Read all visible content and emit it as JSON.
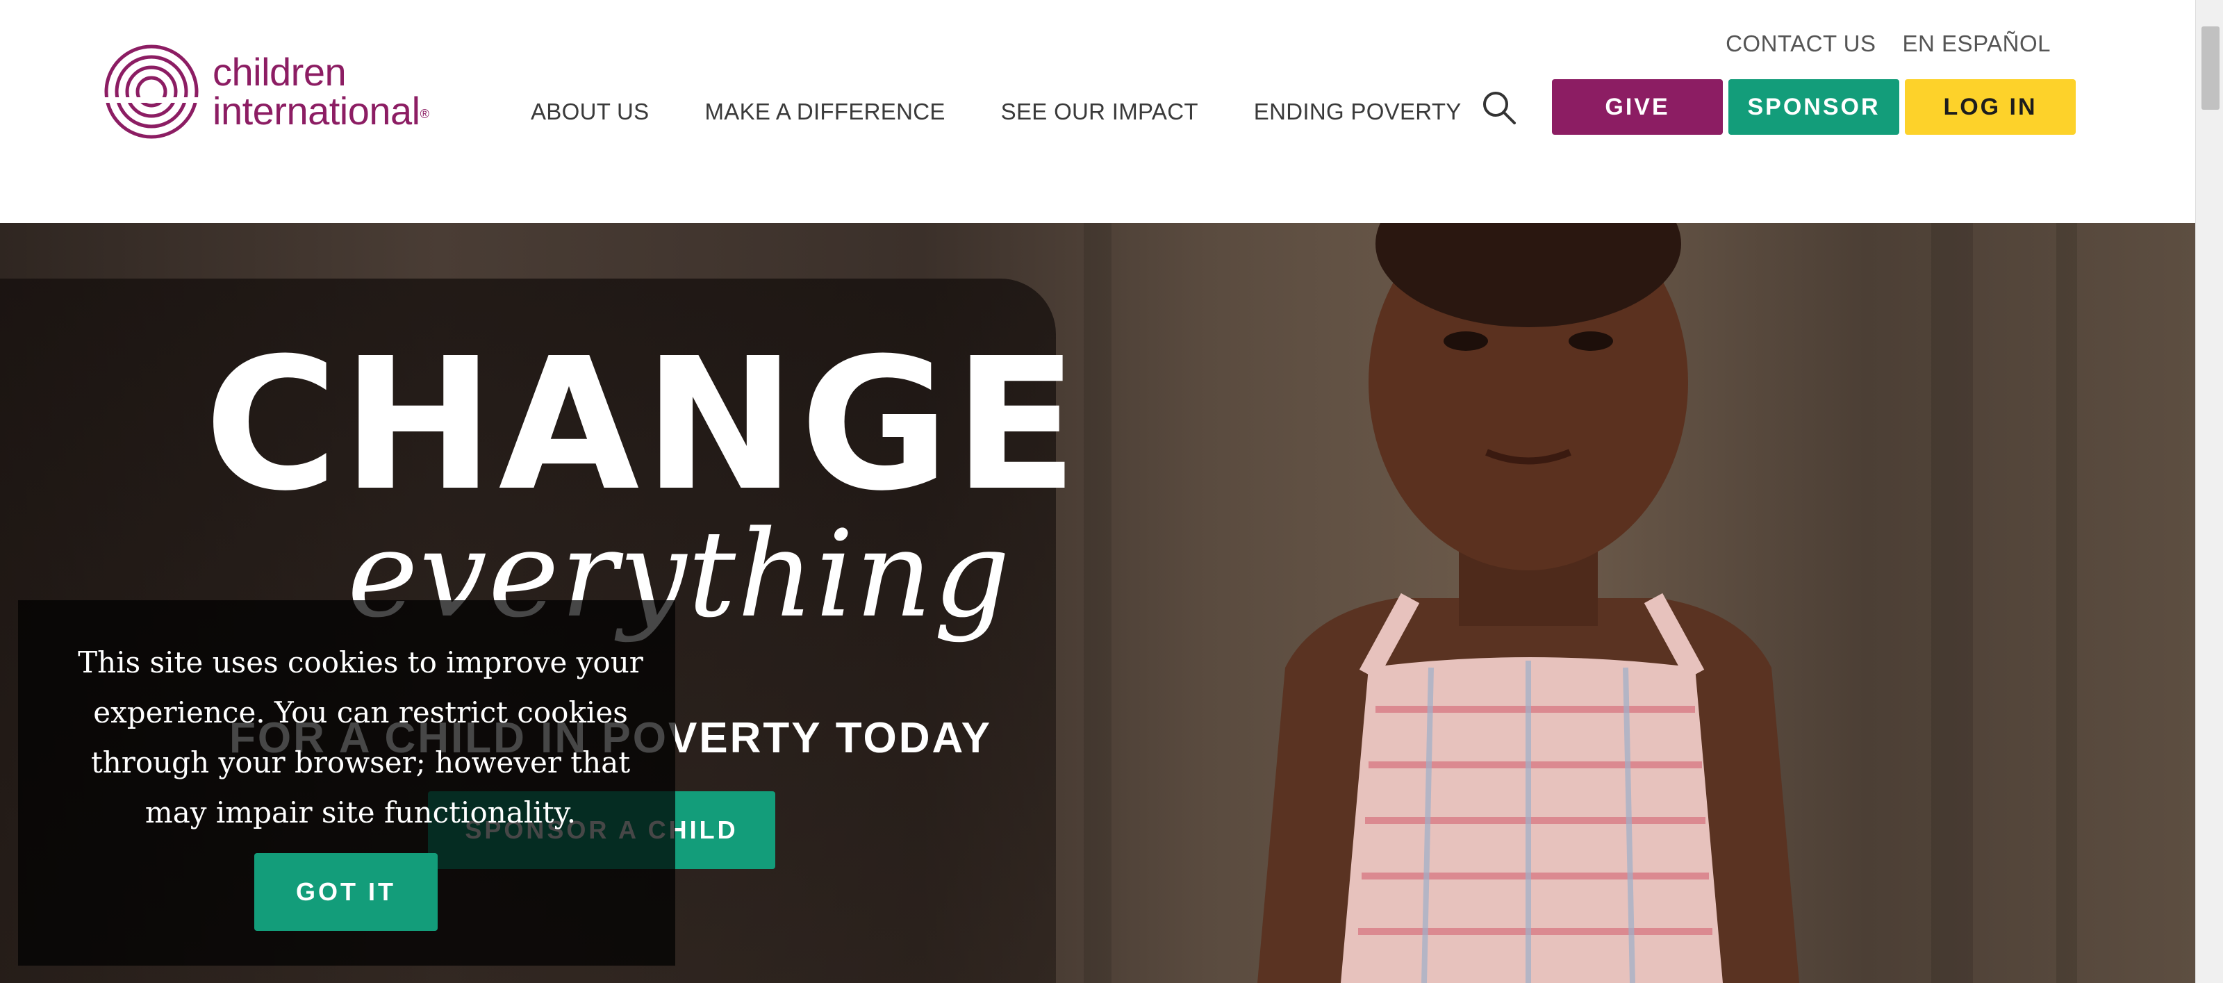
{
  "brand": {
    "line1": "children",
    "line2": "international",
    "registered_mark": "®",
    "color": "#8c1d63"
  },
  "utility_nav": [
    "CONTACT US",
    "EN ESPAÑOL"
  ],
  "main_nav": [
    "ABOUT US",
    "MAKE A DIFFERENCE",
    "SEE OUR IMPACT",
    "ENDING POVERTY"
  ],
  "actions": {
    "give": "GIVE",
    "sponsor": "SPONSOR",
    "login": "LOG IN"
  },
  "hero": {
    "headline": "CHANGE",
    "script": "everything",
    "tagline": "FOR A CHILD IN POVERTY TODAY",
    "cta": "SPONSOR A CHILD"
  },
  "cookie_banner": {
    "message": "This site uses cookies to improve your experience. You can restrict cookies through your browser; however that may impair site functionality.",
    "button": "GOT IT"
  },
  "colors": {
    "brand_purple": "#8c1d63",
    "accent_green": "#139d7a",
    "accent_yellow": "#fdd22a"
  },
  "icons": [
    "logo-rings-icon",
    "search-icon"
  ]
}
